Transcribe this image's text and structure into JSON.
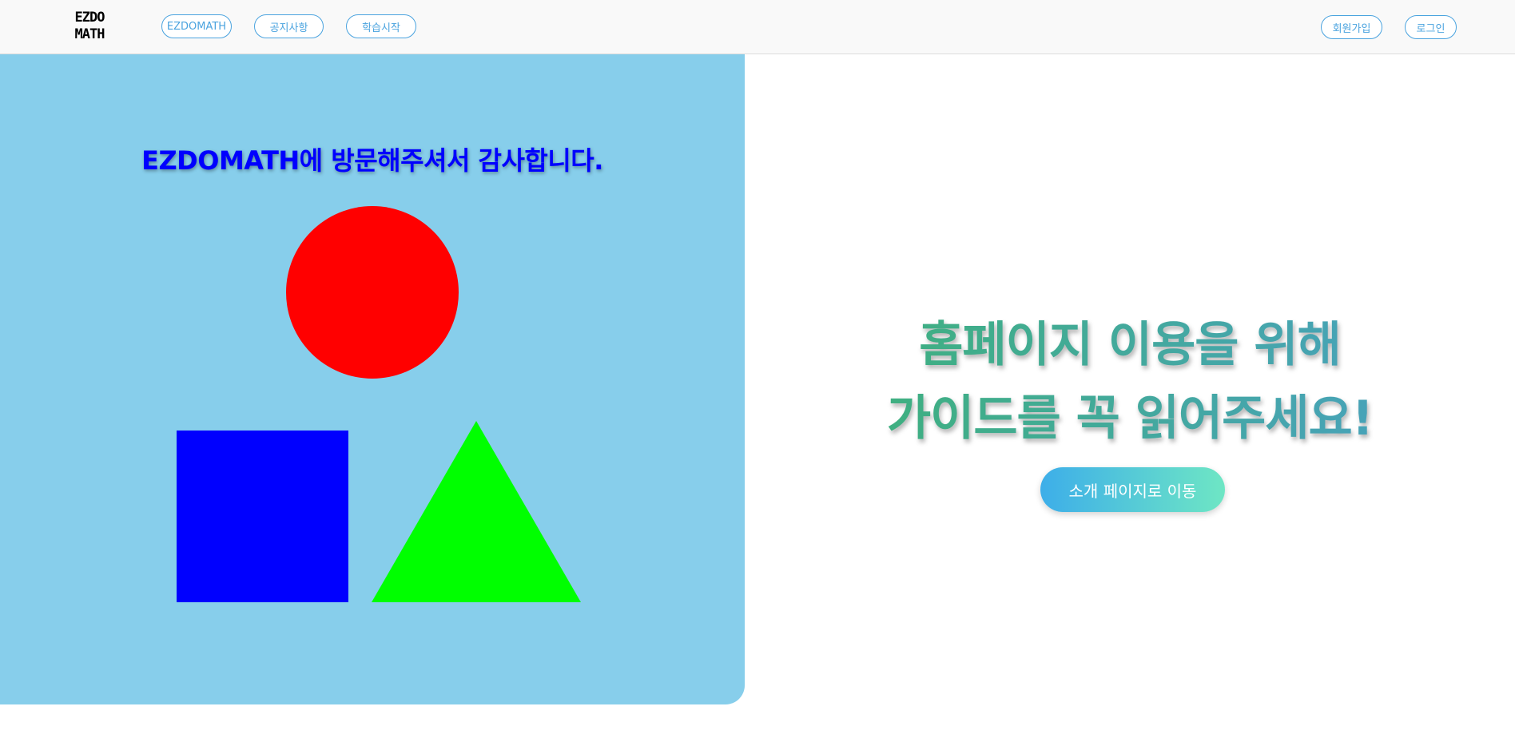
{
  "nav": {
    "logo_line1": "EZDO",
    "logo_line2": "MATH",
    "items": [
      {
        "label": "EZDOMATH"
      },
      {
        "label": "공지사항"
      },
      {
        "label": "학습시작"
      }
    ],
    "signup_label": "회원가입",
    "login_label": "로그인"
  },
  "left": {
    "welcome": "EZDOMATH에 방문해주셔서 감사합니다.",
    "shapes": [
      {
        "name": "circle",
        "color": "#ff0000"
      },
      {
        "name": "square",
        "color": "#0000ff"
      },
      {
        "name": "triangle",
        "color": "#00ff00"
      }
    ],
    "background": "#87ceeb"
  },
  "right": {
    "headline_line1": "홈페이지 이용을 위해",
    "headline_line2": "가이드를 꼭 읽어주세요!",
    "cta_label": "소개 페이지로 이동"
  },
  "colors": {
    "accent": "#4aa3df",
    "headline_gradient_start": "#3cb371",
    "headline_gradient_end": "#4a9fc8"
  }
}
